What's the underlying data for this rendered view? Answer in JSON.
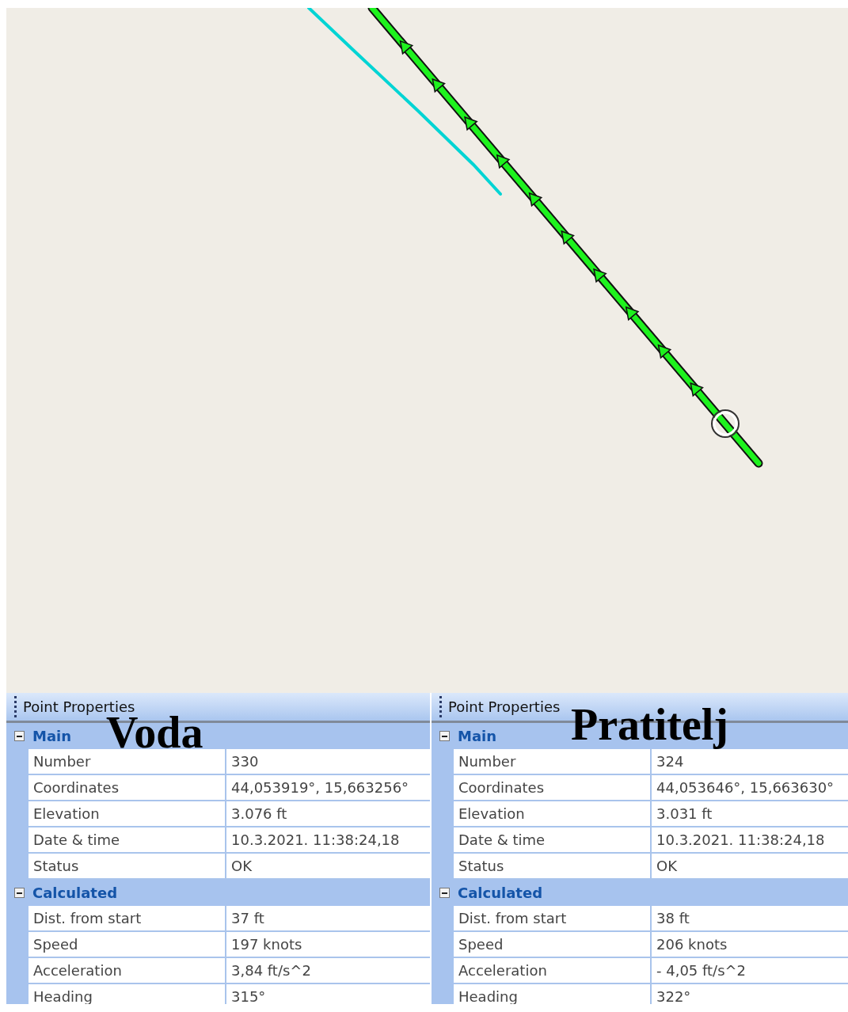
{
  "panels": [
    {
      "title": "Point Properties",
      "overlay_label": "Voda",
      "categories": [
        {
          "name": "Main",
          "expanded": true,
          "properties": [
            {
              "name": "Number",
              "value": "330"
            },
            {
              "name": "Coordinates",
              "value": "44,053919°, 15,663256°"
            },
            {
              "name": "Elevation",
              "value": "3.076 ft"
            },
            {
              "name": "Date & time",
              "value": "10.3.2021. 11:38:24,18"
            },
            {
              "name": "Status",
              "value": "OK"
            }
          ]
        },
        {
          "name": "Calculated",
          "expanded": true,
          "properties": [
            {
              "name": "Dist. from start",
              "value": "37 ft"
            },
            {
              "name": "Speed",
              "value": "197 knots"
            },
            {
              "name": "Acceleration",
              "value": "3,84 ft/s^2"
            },
            {
              "name": "Heading",
              "value": "315°"
            }
          ]
        }
      ]
    },
    {
      "title": "Point Properties",
      "overlay_label": "Pratitelj",
      "categories": [
        {
          "name": "Main",
          "expanded": true,
          "properties": [
            {
              "name": "Number",
              "value": "324"
            },
            {
              "name": "Coordinates",
              "value": "44,053646°, 15,663630°"
            },
            {
              "name": "Elevation",
              "value": "3.031 ft"
            },
            {
              "name": "Date & time",
              "value": "10.3.2021. 11:38:24,18"
            },
            {
              "name": "Status",
              "value": "OK"
            }
          ]
        },
        {
          "name": "Calculated",
          "expanded": true,
          "properties": [
            {
              "name": "Dist. from start",
              "value": "38 ft"
            },
            {
              "name": "Speed",
              "value": "206 knots"
            },
            {
              "name": "Acceleration",
              "value": "- 4,05 ft/s^2"
            },
            {
              "name": "Heading",
              "value": "322°"
            }
          ]
        }
      ]
    }
  ]
}
